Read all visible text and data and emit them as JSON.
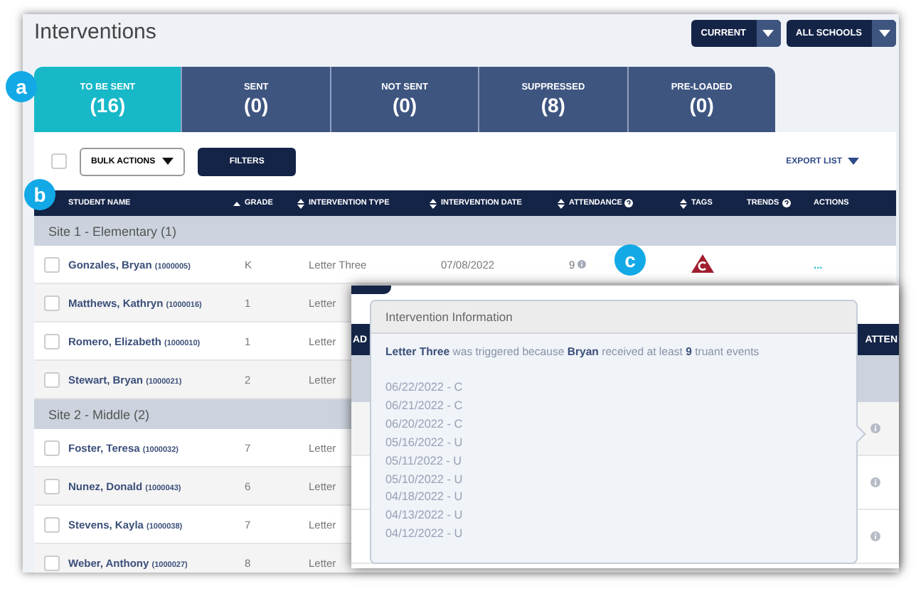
{
  "title": "Interventions",
  "filters": [
    {
      "label": "CURRENT"
    },
    {
      "label": "ALL SCHOOLS"
    }
  ],
  "tabs": [
    {
      "label": "TO BE SENT",
      "count": "(16)",
      "selected": true
    },
    {
      "label": "SENT",
      "count": "(0)",
      "selected": false
    },
    {
      "label": "NOT SENT",
      "count": "(0)",
      "selected": false
    },
    {
      "label": "SUPPRESSED",
      "count": "(8)",
      "selected": false
    },
    {
      "label": "PRE-LOADED",
      "count": "(0)",
      "selected": false
    }
  ],
  "toolbar": {
    "select_all_checked": false,
    "bulk_actions": "BULK ACTIONS",
    "filters": "FILTERS",
    "export": "EXPORT LIST"
  },
  "table": {
    "columns": [
      {
        "label": "STUDENT NAME",
        "sortable": true,
        "sorted": true,
        "help": false
      },
      {
        "label": "GRADE",
        "sortable": true,
        "sorted": false,
        "help": false
      },
      {
        "label": "INTERVENTION TYPE",
        "sortable": true,
        "sorted": false,
        "help": false
      },
      {
        "label": "INTERVENTION DATE",
        "sortable": true,
        "sorted": false,
        "help": false
      },
      {
        "label": "ATTENDANCE",
        "sortable": true,
        "sorted": false,
        "help": true
      },
      {
        "label": "TAGS",
        "sortable": false,
        "help": false
      },
      {
        "label": "TRENDS",
        "sortable": false,
        "help": true
      },
      {
        "label": "ACTIONS",
        "sortable": false,
        "help": false
      }
    ],
    "groups": [
      {
        "name": "Site 1 - Elementary (1)",
        "rows": [
          {
            "name": "Gonzales, Bryan",
            "id": "(1000005)",
            "grade": "K",
            "type": "Letter Three",
            "date": "07/08/2022",
            "attendance": "9",
            "tag": true,
            "actions": "...",
            "checked": false
          },
          {
            "name": "Matthews, Kathryn",
            "id": "(1000016)",
            "grade": "1",
            "type": "Letter",
            "checked": false
          },
          {
            "name": "Romero, Elizabeth",
            "id": "(1000010)",
            "grade": "1",
            "type": "Letter",
            "checked": false
          },
          {
            "name": "Stewart, Bryan",
            "id": "(1000021)",
            "grade": "2",
            "type": "Letter",
            "checked": false
          }
        ]
      },
      {
        "name": "Site 2 - Middle (2)",
        "rows": [
          {
            "name": "Foster, Teresa",
            "id": "(1000032)",
            "grade": "7",
            "type": "Letter",
            "checked": false
          },
          {
            "name": "Nunez, Donald",
            "id": "(1000043)",
            "grade": "6",
            "type": "Letter",
            "checked": false
          },
          {
            "name": "Stevens, Kayla",
            "id": "(1000038)",
            "grade": "7",
            "type": "Letter",
            "checked": false
          },
          {
            "name": "Weber, Anthony",
            "id": "(1000027)",
            "grade": "8",
            "type": "Letter",
            "checked": false
          }
        ]
      }
    ]
  },
  "inset": {
    "headers": [
      "AD",
      "ATTEN"
    ],
    "popup": {
      "title": "Intervention Information",
      "message": "**Letter Three** was triggered because **Bryan** received at least **9** truant events",
      "events": [
        "06/22/2022 - C",
        "06/21/2022 - C",
        "06/20/2022 - C",
        "05/16/2022 - U",
        "05/11/2022 - U",
        "05/10/2022 - U",
        "04/18/2022 - U",
        "04/13/2022 - U",
        "04/12/2022 - U"
      ]
    }
  },
  "annotations": [
    {
      "label": "a"
    },
    {
      "label": "b"
    },
    {
      "label": "c"
    }
  ]
}
